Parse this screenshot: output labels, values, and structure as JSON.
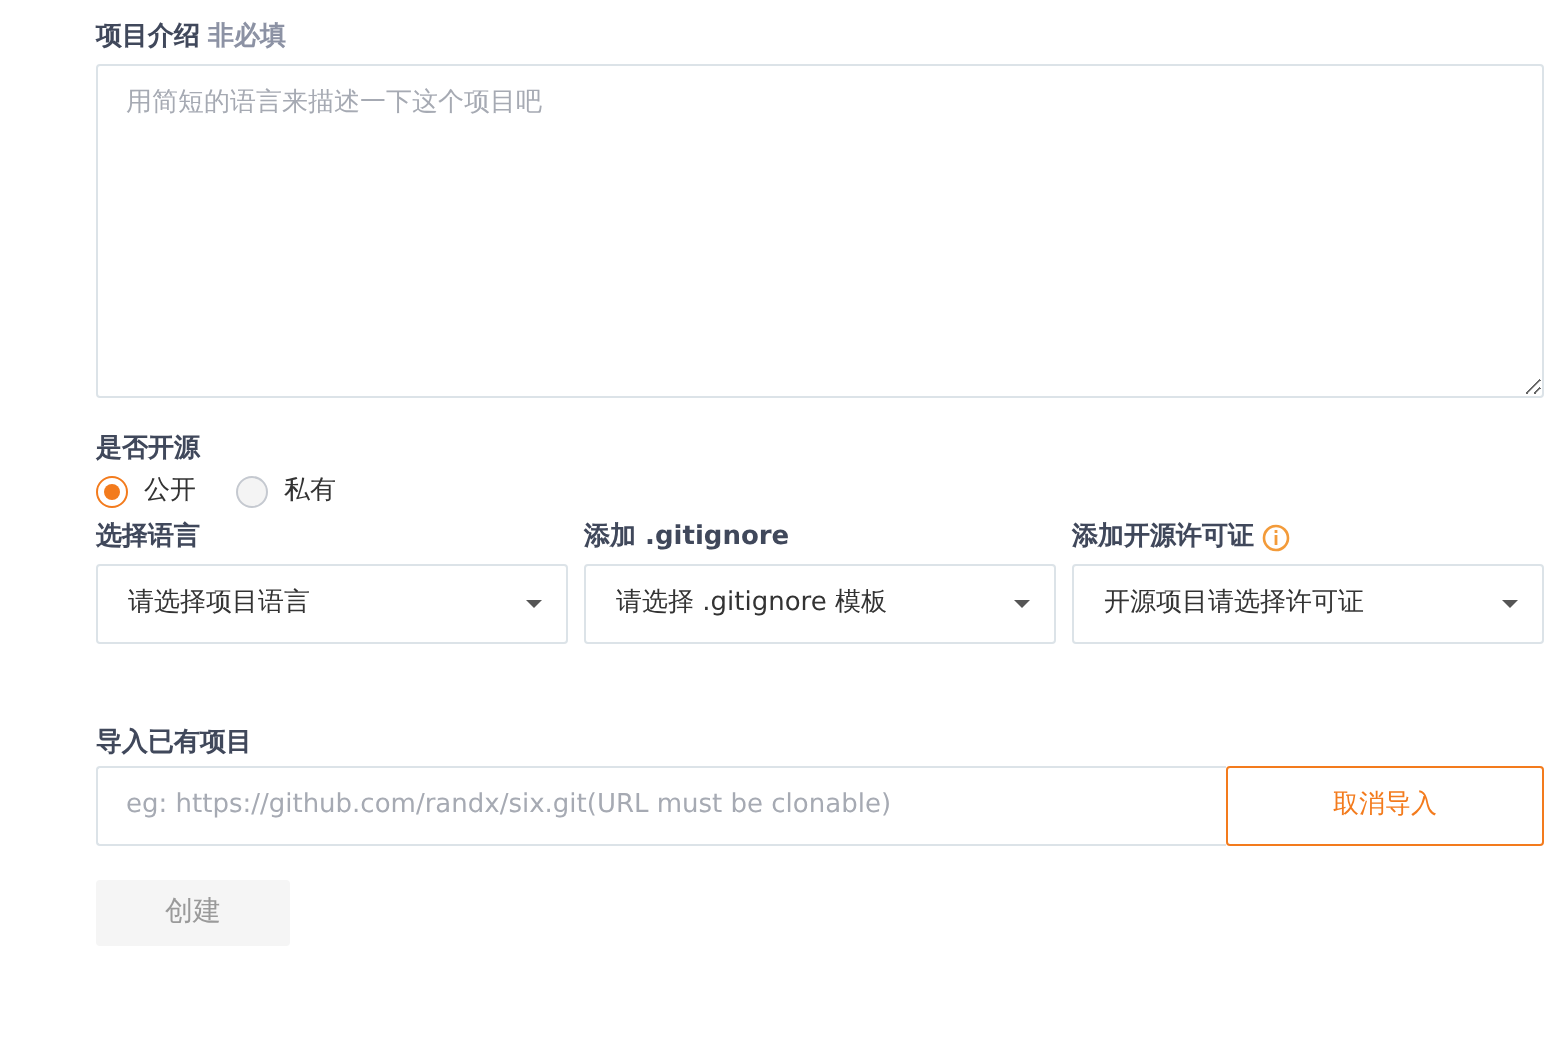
{
  "description": {
    "label": "项目介绍",
    "note": "非必填",
    "placeholder": "用简短的语言来描述一下这个项目吧"
  },
  "open_source": {
    "label": "是否开源",
    "options": [
      {
        "label": "公开",
        "selected": true
      },
      {
        "label": "私有",
        "selected": false
      }
    ]
  },
  "selects": [
    {
      "label": "选择语言",
      "info": false,
      "value": "请选择项目语言"
    },
    {
      "label": "添加 .gitignore",
      "info": false,
      "value": "请选择 .gitignore 模板"
    },
    {
      "label": "添加开源许可证",
      "info": true,
      "value": "开源项目请选择许可证"
    }
  ],
  "import": {
    "label": "导入已有项目",
    "placeholder": "eg: https://github.com/randx/six.git(URL must be clonable)",
    "cancel_button": "取消导入"
  },
  "create_button": {
    "label": "创建",
    "disabled": true
  }
}
